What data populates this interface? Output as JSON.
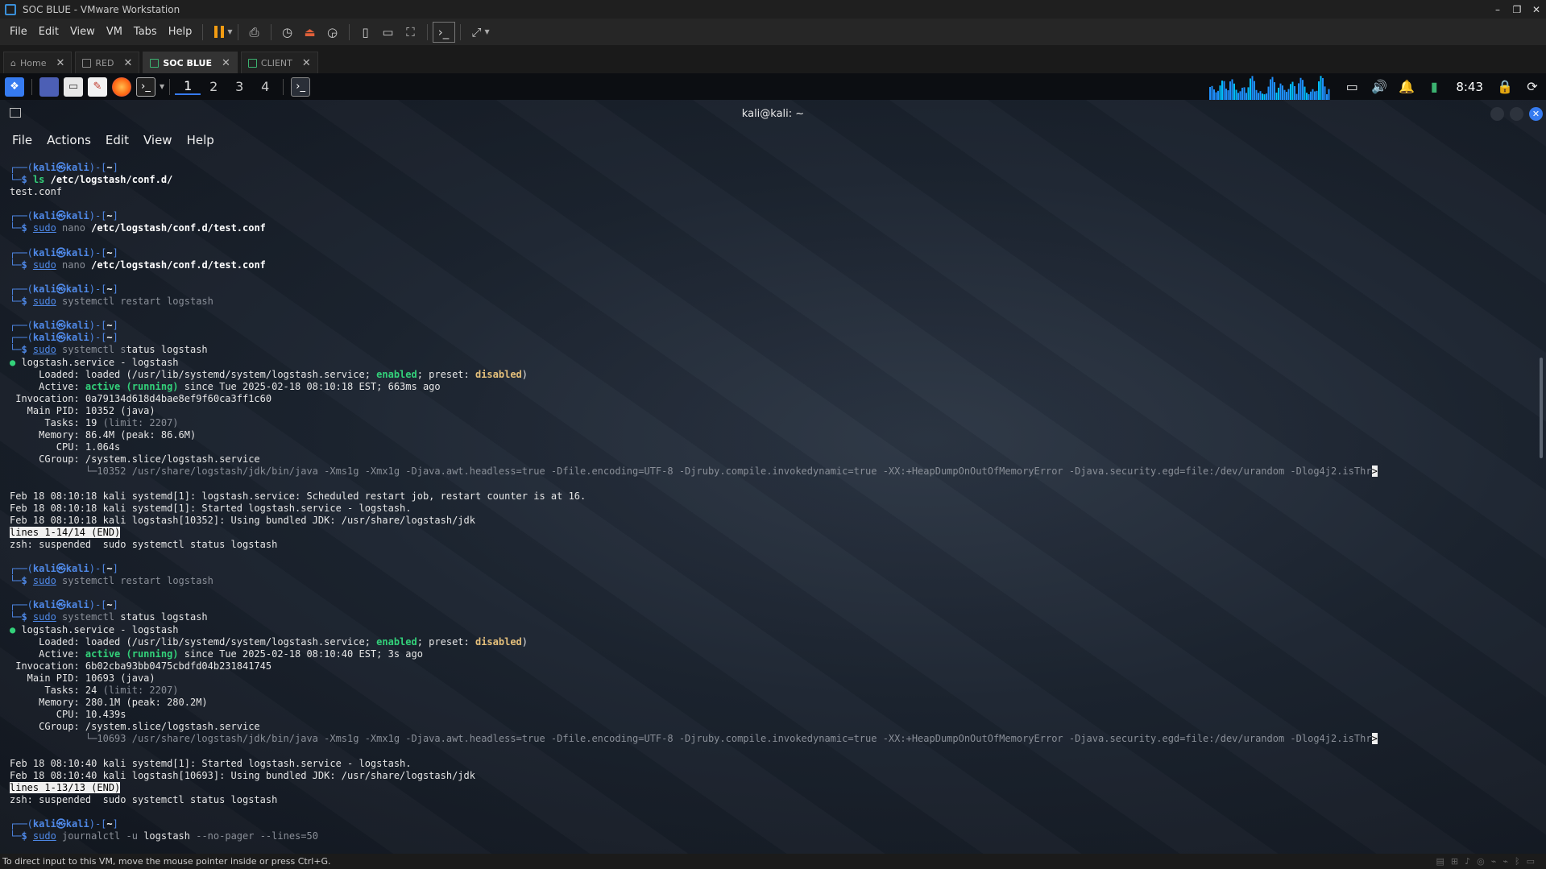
{
  "window": {
    "title": "SOC BLUE - VMware Workstation",
    "controls": [
      "–",
      "❐",
      "✕"
    ]
  },
  "vm_menu": [
    "File",
    "Edit",
    "View",
    "VM",
    "Tabs",
    "Help"
  ],
  "vm_tabs": [
    {
      "label": "Home"
    },
    {
      "label": "RED"
    },
    {
      "label": "SOC BLUE"
    },
    {
      "label": "CLIENT"
    }
  ],
  "kali_panel": {
    "workspaces": [
      "1",
      "2",
      "3",
      "4"
    ],
    "clock": "8:43"
  },
  "terminal": {
    "title": "kali@kali: ~",
    "menu": [
      "File",
      "Actions",
      "Edit",
      "View",
      "Help"
    ],
    "lines": [
      [
        {
          "t": "┌──(",
          "c": "bl"
        },
        {
          "t": "kali㉿kali",
          "c": "pb"
        },
        {
          "t": ")-[",
          "c": "bl"
        },
        {
          "t": "~",
          "c": "bold"
        },
        {
          "t": "]",
          "c": "bl"
        }
      ],
      [
        {
          "t": "└─",
          "c": "bl"
        },
        {
          "t": "$ ",
          "c": "pb"
        },
        {
          "t": "ls ",
          "c": "gr"
        },
        {
          "t": "/etc/logstash/conf.d/",
          "c": "bold"
        }
      ],
      [
        {
          "t": "test.conf",
          "c": ""
        }
      ],
      [],
      [
        {
          "t": "┌──(",
          "c": "bl"
        },
        {
          "t": "kali㉿kali",
          "c": "pb"
        },
        {
          "t": ")-[",
          "c": "bl"
        },
        {
          "t": "~",
          "c": "bold"
        },
        {
          "t": "]",
          "c": "bl"
        }
      ],
      [
        {
          "t": "└─",
          "c": "bl"
        },
        {
          "t": "$ ",
          "c": "pb"
        },
        {
          "t": "sudo",
          "c": "ul"
        },
        {
          "t": " nano ",
          "c": "gy"
        },
        {
          "t": "/etc/logstash/conf.d/test.conf",
          "c": "bold"
        }
      ],
      [],
      [
        {
          "t": "┌──(",
          "c": "bl"
        },
        {
          "t": "kali㉿kali",
          "c": "pb"
        },
        {
          "t": ")-[",
          "c": "bl"
        },
        {
          "t": "~",
          "c": "bold"
        },
        {
          "t": "]",
          "c": "bl"
        }
      ],
      [
        {
          "t": "└─",
          "c": "bl"
        },
        {
          "t": "$ ",
          "c": "pb"
        },
        {
          "t": "sudo",
          "c": "ul"
        },
        {
          "t": " nano ",
          "c": "gy"
        },
        {
          "t": "/etc/logstash/conf.d/test.conf",
          "c": "bold"
        }
      ],
      [],
      [
        {
          "t": "┌──(",
          "c": "bl"
        },
        {
          "t": "kali㉿kali",
          "c": "pb"
        },
        {
          "t": ")-[",
          "c": "bl"
        },
        {
          "t": "~",
          "c": "bold"
        },
        {
          "t": "]",
          "c": "bl"
        }
      ],
      [
        {
          "t": "└─",
          "c": "bl"
        },
        {
          "t": "$ ",
          "c": "pb"
        },
        {
          "t": "sudo",
          "c": "ul"
        },
        {
          "t": " systemctl restart logstash",
          "c": "gy"
        }
      ],
      [],
      [
        {
          "t": "┌──(",
          "c": "bl"
        },
        {
          "t": "kali㉿kali",
          "c": "pb"
        },
        {
          "t": ")-[",
          "c": "bl"
        },
        {
          "t": "~",
          "c": "bold"
        },
        {
          "t": "]",
          "c": "bl"
        }
      ],
      [
        {
          "t": "┌──(",
          "c": "bl"
        },
        {
          "t": "kali㉿kali",
          "c": "pb"
        },
        {
          "t": ")-[",
          "c": "bl"
        },
        {
          "t": "~",
          "c": "bold"
        },
        {
          "t": "]",
          "c": "bl"
        }
      ],
      [
        {
          "t": "└─",
          "c": "bl"
        },
        {
          "t": "$ ",
          "c": "pb"
        },
        {
          "t": "sudo",
          "c": "ul"
        },
        {
          "t": " systemctl s",
          "c": "gy"
        },
        {
          "t": "tatus logstash",
          "c": ""
        }
      ],
      [
        {
          "t": "● ",
          "c": "dot"
        },
        {
          "t": "logstash.service - logstash",
          "c": ""
        }
      ],
      [
        {
          "t": "     Loaded: loaded (/usr/lib/systemd/system/logstash.service; ",
          "c": ""
        },
        {
          "t": "enabled",
          "c": "gr"
        },
        {
          "t": "; preset: ",
          "c": ""
        },
        {
          "t": "disabled",
          "c": "yl"
        },
        {
          "t": ")",
          "c": ""
        }
      ],
      [
        {
          "t": "     Active: ",
          "c": ""
        },
        {
          "t": "active (running)",
          "c": "gr"
        },
        {
          "t": " since Tue 2025-02-18 08:10:18 EST; 663ms ago",
          "c": ""
        }
      ],
      [
        {
          "t": " Invocation: 0a79134d618d4bae8ef9f60ca3ff1c60",
          "c": ""
        }
      ],
      [
        {
          "t": "   Main PID: 10352 (java)",
          "c": ""
        }
      ],
      [
        {
          "t": "      Tasks: 19 ",
          "c": ""
        },
        {
          "t": "(limit: 2207)",
          "c": "gy"
        }
      ],
      [
        {
          "t": "     Memory: 86.4M (peak: 86.6M)",
          "c": ""
        }
      ],
      [
        {
          "t": "        CPU: 1.064s",
          "c": ""
        }
      ],
      [
        {
          "t": "     CGroup: /system.slice/logstash.service",
          "c": ""
        }
      ],
      [
        {
          "t": "             └─10352 /usr/share/logstash/jdk/bin/java -Xms1g -Xmx1g -Djava.awt.headless=true -Dfile.encoding=UTF-8 -Djruby.compile.invokedynamic=true -XX:+HeapDumpOnOutOfMemoryError -Djava.security.egd=file:/dev/urandom -Dlog4j2.isThr",
          "c": "gy"
        },
        {
          "t": ">",
          "c": "cursor"
        }
      ],
      [],
      [
        {
          "t": "Feb 18 08:10:18 kali systemd[1]: logstash.service: Scheduled restart job, restart counter is at 16.",
          "c": ""
        }
      ],
      [
        {
          "t": "Feb 18 08:10:18 kali systemd[1]: Started logstash.service - logstash.",
          "c": ""
        }
      ],
      [
        {
          "t": "Feb 18 08:10:18 kali logstash[10352]: Using bundled JDK: /usr/share/logstash/jdk",
          "c": ""
        }
      ],
      [
        {
          "t": "lines 1-14/14 (END)",
          "c": "inv"
        }
      ],
      [
        {
          "t": "zsh: suspended  sudo systemctl status logstash",
          "c": ""
        }
      ],
      [],
      [
        {
          "t": "┌──(",
          "c": "bl"
        },
        {
          "t": "kali㉿kali",
          "c": "pb"
        },
        {
          "t": ")-[",
          "c": "bl"
        },
        {
          "t": "~",
          "c": "bold"
        },
        {
          "t": "]",
          "c": "bl"
        }
      ],
      [
        {
          "t": "└─",
          "c": "bl"
        },
        {
          "t": "$ ",
          "c": "pb"
        },
        {
          "t": "sudo",
          "c": "ul"
        },
        {
          "t": " systemctl res",
          "c": "gy"
        },
        {
          "t": "tart logstash",
          "c": "gy"
        }
      ],
      [],
      [
        {
          "t": "┌──(",
          "c": "bl"
        },
        {
          "t": "kali㉿kali",
          "c": "pb"
        },
        {
          "t": ")-[",
          "c": "bl"
        },
        {
          "t": "~",
          "c": "bold"
        },
        {
          "t": "]",
          "c": "bl"
        }
      ],
      [
        {
          "t": "└─",
          "c": "bl"
        },
        {
          "t": "$ ",
          "c": "pb"
        },
        {
          "t": "sudo",
          "c": "ul"
        },
        {
          "t": " systemctl",
          "c": "gy"
        },
        {
          "t": " status logstash",
          "c": ""
        }
      ],
      [
        {
          "t": "● ",
          "c": "dot"
        },
        {
          "t": "logstash.service - logstash",
          "c": ""
        }
      ],
      [
        {
          "t": "     Loaded: loaded (/usr/lib/systemd/system/logstash.service; ",
          "c": ""
        },
        {
          "t": "enabled",
          "c": "gr"
        },
        {
          "t": "; preset: ",
          "c": ""
        },
        {
          "t": "disabled",
          "c": "yl"
        },
        {
          "t": ")",
          "c": ""
        }
      ],
      [
        {
          "t": "     Active: ",
          "c": ""
        },
        {
          "t": "active (running)",
          "c": "gr"
        },
        {
          "t": " since Tue 2025-02-18 08:10:40 EST; 3s ago",
          "c": ""
        }
      ],
      [
        {
          "t": " Invocation: 6b02cba93bb0475cbdfd04b231841745",
          "c": ""
        }
      ],
      [
        {
          "t": "   Main PID: 10693 (java)",
          "c": ""
        }
      ],
      [
        {
          "t": "      Tasks: 24 ",
          "c": ""
        },
        {
          "t": "(limit: 2207)",
          "c": "gy"
        }
      ],
      [
        {
          "t": "     Memory: 280.1M (peak: 280.2M)",
          "c": ""
        }
      ],
      [
        {
          "t": "        CPU: 10.439s",
          "c": ""
        }
      ],
      [
        {
          "t": "     CGroup: /system.slice/logstash.service",
          "c": ""
        }
      ],
      [
        {
          "t": "             └─10693 /usr/share/logstash/jdk/bin/java -Xms1g -Xmx1g -Djava.awt.headless=true -Dfile.encoding=UTF-8 -Djruby.compile.invokedynamic=true -XX:+HeapDumpOnOutOfMemoryError -Djava.security.egd=file:/dev/urandom -Dlog4j2.isThr",
          "c": "gy"
        },
        {
          "t": ">",
          "c": "cursor"
        }
      ],
      [],
      [
        {
          "t": "Feb 18 08:10:40 kali systemd[1]: Started logstash.service - logstash.",
          "c": ""
        }
      ],
      [
        {
          "t": "Feb 18 08:10:40 kali logstash[10693]: Using bundled JDK: /usr/share/logstash/jdk",
          "c": ""
        }
      ],
      [
        {
          "t": "lines 1-13/13 (END)",
          "c": "inv"
        }
      ],
      [
        {
          "t": "zsh: suspended  sudo systemctl status logstash",
          "c": ""
        }
      ],
      [],
      [
        {
          "t": "┌──(",
          "c": "bl"
        },
        {
          "t": "kali㉿kali",
          "c": "pb"
        },
        {
          "t": ")-[",
          "c": "bl"
        },
        {
          "t": "~",
          "c": "bold"
        },
        {
          "t": "]",
          "c": "bl"
        }
      ],
      [
        {
          "t": "└─",
          "c": "bl"
        },
        {
          "t": "$ ",
          "c": "pb"
        },
        {
          "t": "sudo",
          "c": "ul"
        },
        {
          "t": " journalctl",
          "c": "gy"
        },
        {
          "t": " -u ",
          "c": "gy"
        },
        {
          "t": "logstash",
          "c": ""
        },
        {
          "t": " --no-pager --lines=50",
          "c": "gy"
        }
      ]
    ]
  },
  "status_bar": {
    "message": "To direct input to this VM, move the mouse pointer inside or press Ctrl+G."
  },
  "colors": {
    "accent": "#367bf0",
    "prompt": "#4f89e8",
    "ok": "#33d17a",
    "warn": "#e5c07b"
  }
}
